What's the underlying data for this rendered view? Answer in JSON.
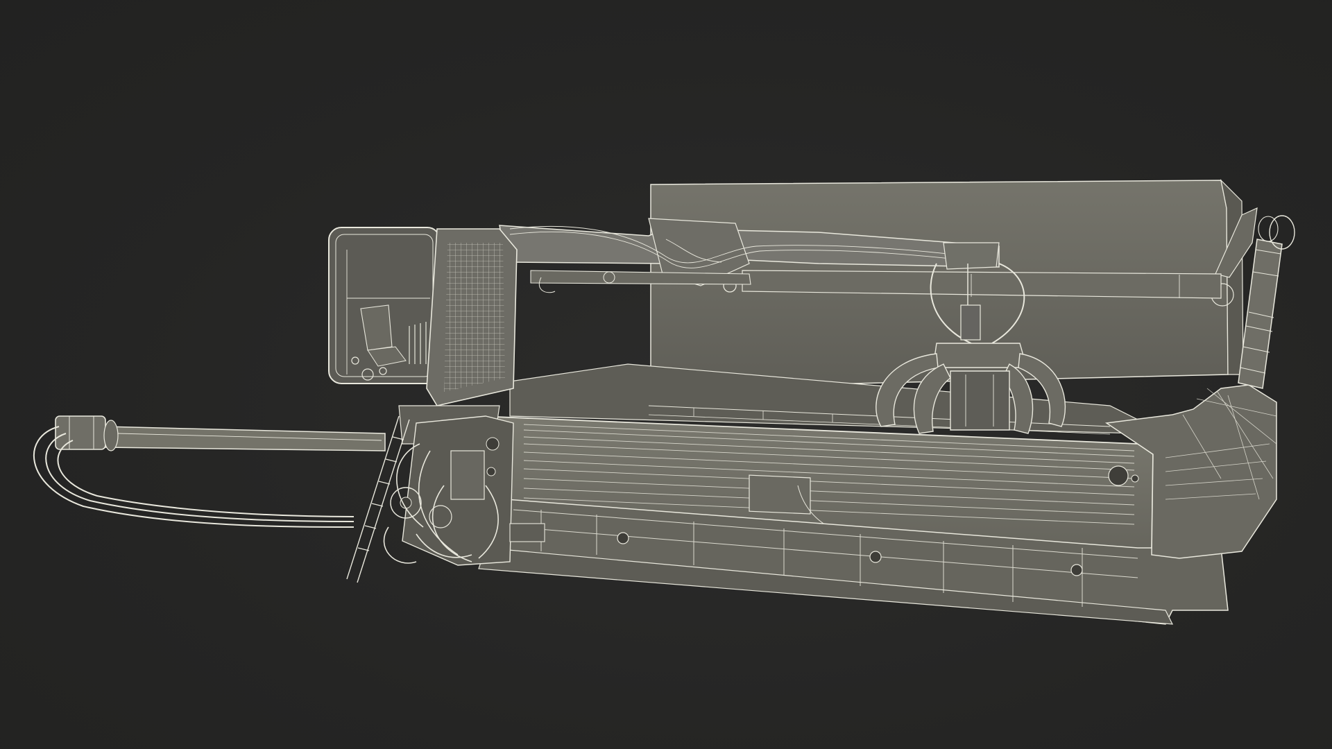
{
  "scene": {
    "subject": "wireframe-render",
    "colors": {
      "background": "#262626",
      "shell": "#6d6c64",
      "shell_dark": "#57564f",
      "shell_light": "#7c7b72",
      "wire": "#e9e8dd",
      "wire_dim": "#bdbcb2"
    }
  }
}
